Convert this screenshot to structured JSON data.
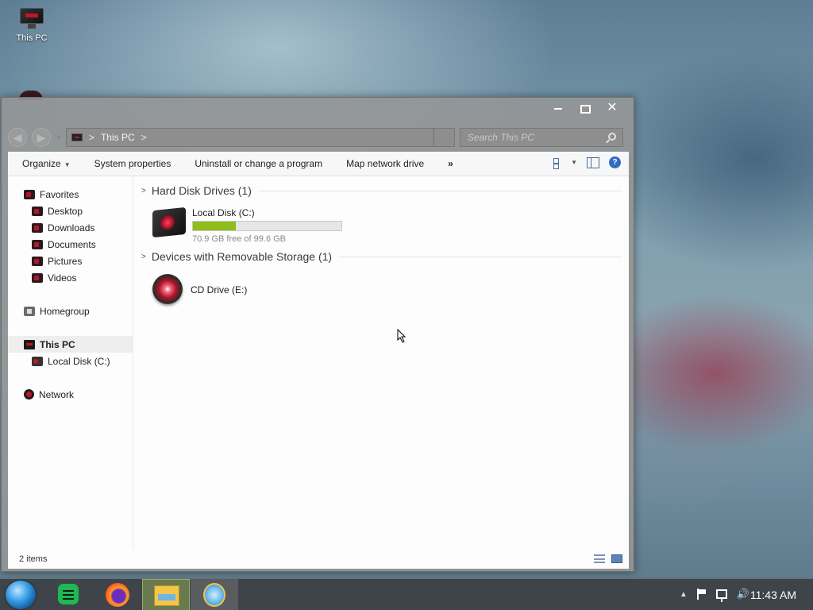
{
  "desktop": {
    "icons": [
      {
        "label": "This PC",
        "icon": "this-pc-icon"
      }
    ]
  },
  "window": {
    "controls": {
      "minimize": "minimize",
      "maximize": "maximize",
      "close": "✕"
    },
    "nav": {
      "back": "◀",
      "forward": "▶",
      "recent": "▼"
    },
    "address": {
      "crumbs": [
        "This PC"
      ],
      "separator": ">"
    },
    "search": {
      "placeholder": "Search This PC"
    },
    "toolbar": {
      "items": [
        "Organize",
        "System properties",
        "Uninstall or change a program",
        "Map network drive"
      ],
      "organize_caret": "▼",
      "more": "»"
    },
    "sidebar": {
      "favorites": {
        "label": "Favorites",
        "items": [
          "Desktop",
          "Downloads",
          "Documents",
          "Pictures",
          "Videos"
        ]
      },
      "homegroup": "Homegroup",
      "this_pc": {
        "label": "This PC",
        "items": [
          "Local Disk (C:)"
        ]
      },
      "network": "Network"
    },
    "content": {
      "groups": [
        {
          "header": "Hard Disk Drives (1)",
          "drives": [
            {
              "name": "Local Disk (C:)",
              "free_text": "70.9 GB free of 99.6 GB",
              "used_fraction": 0.288
            }
          ]
        },
        {
          "header": "Devices with Removable Storage (1)",
          "drives": [
            {
              "name": "CD Drive (E:)"
            }
          ]
        }
      ]
    },
    "status": {
      "items_count": "2 items"
    }
  },
  "taskbar": {
    "apps": [
      "start-orb",
      "notes-app",
      "firefox",
      "file-explorer",
      "internet-explorer"
    ],
    "active_app": "file-explorer",
    "tray": {
      "expand": "▲"
    },
    "clock": "11:43 AM"
  },
  "colors": {
    "drive_bar_fill": "#8fbd1a",
    "accent_red": "#c0152b",
    "help_blue": "#2f6cc3"
  }
}
